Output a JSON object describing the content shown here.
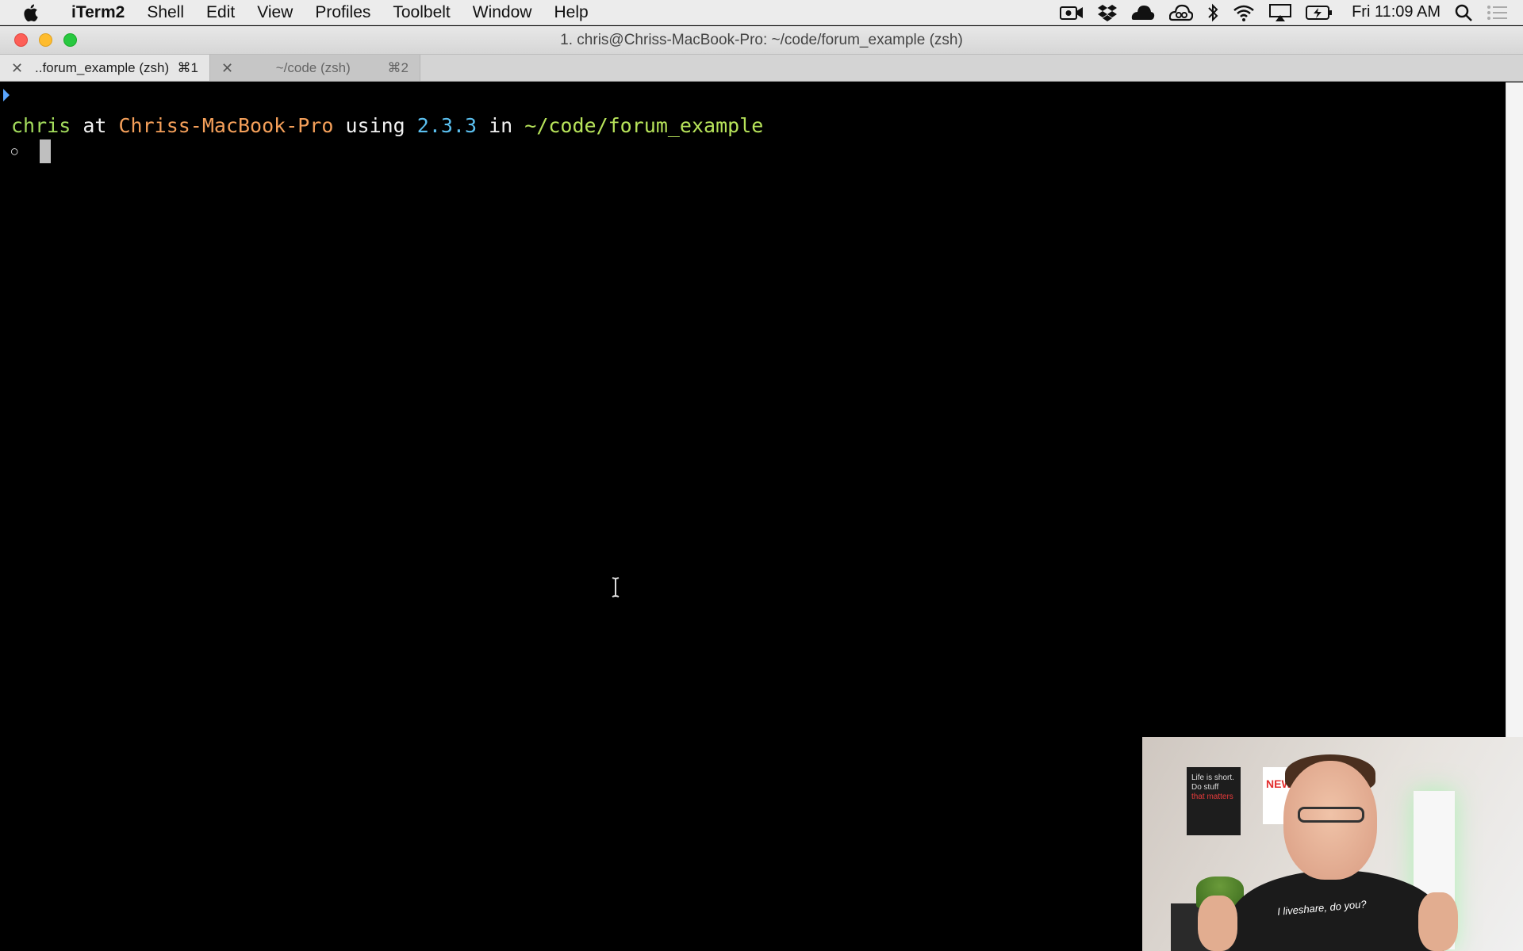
{
  "menubar": {
    "app_name": "iTerm2",
    "items": [
      "Shell",
      "Edit",
      "View",
      "Profiles",
      "Toolbelt",
      "Window",
      "Help"
    ],
    "status_icons": [
      "camera-icon",
      "dropbox-icon",
      "cloud-app-icon",
      "creative-cloud-icon",
      "bluetooth-icon",
      "wifi-icon",
      "airplay-icon",
      "battery-icon"
    ],
    "clock": "Fri 11:09 AM"
  },
  "window": {
    "title": "1. chris@Chriss-MacBook-Pro: ~/code/forum_example (zsh)"
  },
  "tabs": [
    {
      "label": "..forum_example (zsh)",
      "shortcut": "⌘1",
      "active": true
    },
    {
      "label": "~/code (zsh)",
      "shortcut": "⌘2",
      "active": false
    }
  ],
  "terminal": {
    "prompt": {
      "user": "chris",
      "at": " at ",
      "host": "Chriss-MacBook-Pro",
      "using": " using ",
      "version": "2.3.3",
      "in": " in ",
      "path": "~/code/forum_example"
    },
    "input_symbol": "○",
    "colors": {
      "user": "#a3dc5c",
      "host": "#f5a05a",
      "version": "#5bc0f0",
      "path": "#b7e35a"
    }
  },
  "webcam": {
    "poster_left": "Life is short. Do stuff",
    "poster_left_red": "that matters",
    "poster_right": "NEW STO HACK",
    "shirt": "I liveshare, do you?"
  }
}
